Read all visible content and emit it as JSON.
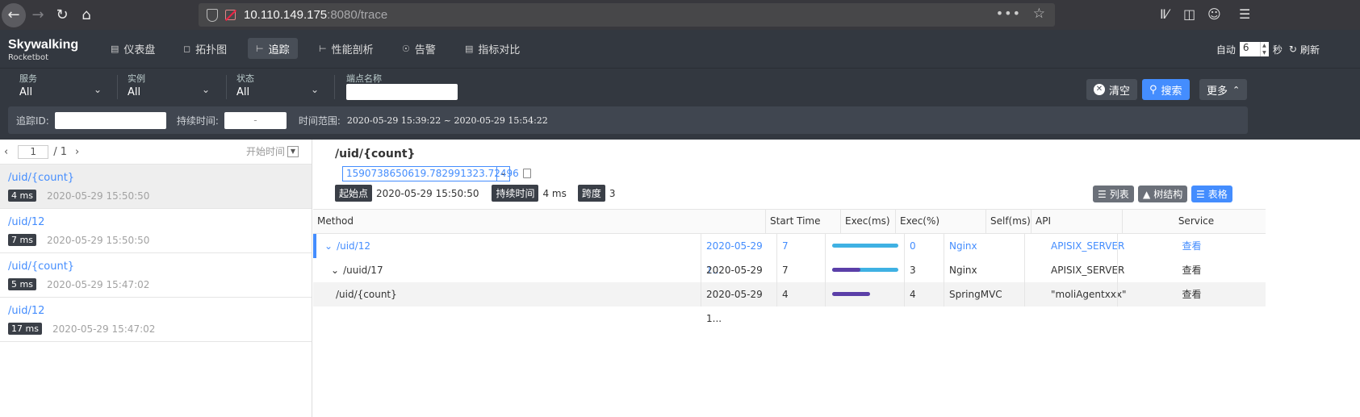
{
  "browser": {
    "url_host": "10.110.149.175",
    "url_path": ":8080/trace"
  },
  "header": {
    "logo_line1": "Skywalking",
    "logo_line2": "Rocketbot",
    "nav": [
      {
        "label": "仪表盘",
        "icon": "bar-chart-icon"
      },
      {
        "label": "拓扑图",
        "icon": "topology-icon"
      },
      {
        "label": "追踪",
        "icon": "trace-icon",
        "active": true
      },
      {
        "label": "性能剖析",
        "icon": "profile-icon"
      },
      {
        "label": "告警",
        "icon": "alarm-icon"
      },
      {
        "label": "指标对比",
        "icon": "compare-icon"
      }
    ],
    "auto_label": "自动",
    "interval_value": "6",
    "seconds_label": "秒",
    "refresh_label": "刷新"
  },
  "filters": {
    "service": {
      "label": "服务",
      "value": "All"
    },
    "instance": {
      "label": "实例",
      "value": "All"
    },
    "status": {
      "label": "状态",
      "value": "All"
    },
    "endpoint": {
      "label": "端点名称",
      "value": ""
    },
    "clear_label": "清空",
    "search_label": "搜索",
    "more_label": "更多",
    "trace_id_label": "追踪ID:",
    "duration_label": "持续时间:",
    "duration_sep": "-",
    "time_range_label": "时间范围:",
    "time_range_value": "2020-05-29 15:39:22 ~ 2020-05-29 15:54:22"
  },
  "trace_list": {
    "page": "1",
    "total_pages": "/ 1",
    "sort_label": "开始时间",
    "items": [
      {
        "name": "/uid/{count}",
        "duration": "4 ms",
        "time": "2020-05-29 15:50:50",
        "selected": true
      },
      {
        "name": "/uid/12",
        "duration": "7 ms",
        "time": "2020-05-29 15:50:50"
      },
      {
        "name": "/uid/{count}",
        "duration": "5 ms",
        "time": "2020-05-29 15:47:02"
      },
      {
        "name": "/uid/12",
        "duration": "17 ms",
        "time": "2020-05-29 15:47:02"
      }
    ]
  },
  "detail": {
    "title": "/uid/{count}",
    "trace_id": "1590738650619.782991323.72496",
    "start_label": "起始点",
    "start_value": "2020-05-29 15:50:50",
    "duration_label": "持续时间",
    "duration_value": "4 ms",
    "span_label": "跨度",
    "span_value": "3",
    "views": {
      "list": "列表",
      "tree": "树结构",
      "table": "表格"
    }
  },
  "span_table": {
    "headers": [
      "Method",
      "Start Time",
      "Exec(ms)",
      "Exec(%)",
      "Self(ms)",
      "API",
      "Service"
    ],
    "rows": [
      {
        "method": "/uid/12",
        "start_time": "2020-05-29 1...",
        "exec_ms": "7",
        "exec_pct": 100,
        "self_ms": "0",
        "api": "Nginx",
        "service": "APISIX_SERVER",
        "action": "查看",
        "highlight": true,
        "expand": true
      },
      {
        "method": "/uuid/17",
        "start_time": "2020-05-29 1...",
        "exec_ms": "7",
        "exec_pct": 100,
        "self_pct": 43,
        "self_ms": "3",
        "api": "Nginx",
        "service": "APISIX_SERVER",
        "action": "查看",
        "expand": true
      },
      {
        "method": "/uid/{count}",
        "start_time": "2020-05-29 1...",
        "exec_ms": "4",
        "exec_pct": 57,
        "self_ms": "4",
        "api": "SpringMVC",
        "service": "\"moliAgentxxx\"",
        "action": "查看"
      }
    ]
  },
  "colors": {
    "accent": "#448dfe",
    "header_bg": "#333840",
    "bar_exec": "#3fb1e3",
    "bar_self": "#5b3fa8"
  }
}
